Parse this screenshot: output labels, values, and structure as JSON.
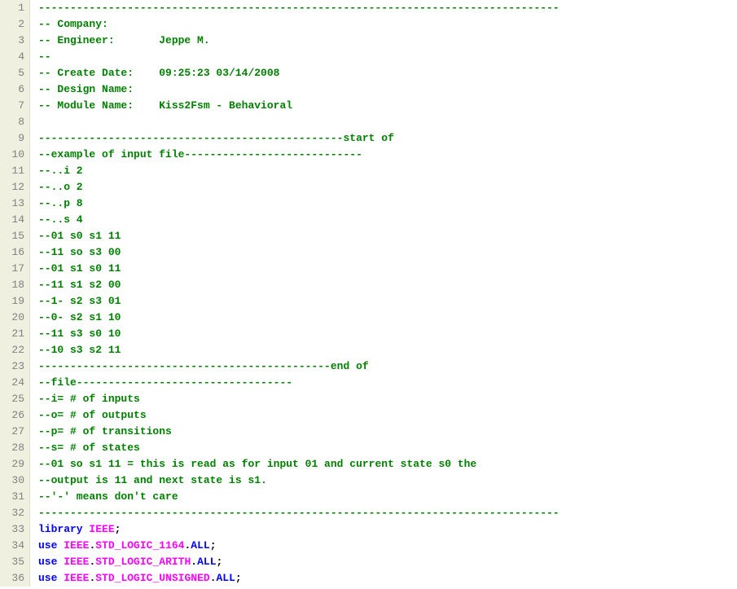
{
  "lines": [
    {
      "n": 1,
      "tokens": [
        {
          "cls": "comment",
          "t": "----------------------------------------------------------------------------------"
        }
      ]
    },
    {
      "n": 2,
      "tokens": [
        {
          "cls": "comment",
          "t": "-- Company: "
        }
      ]
    },
    {
      "n": 3,
      "tokens": [
        {
          "cls": "comment",
          "t": "-- Engineer:       Jeppe M."
        }
      ]
    },
    {
      "n": 4,
      "tokens": [
        {
          "cls": "comment",
          "t": "--"
        }
      ]
    },
    {
      "n": 5,
      "tokens": [
        {
          "cls": "comment",
          "t": "-- Create Date:    09:25:23 03/14/2008"
        }
      ]
    },
    {
      "n": 6,
      "tokens": [
        {
          "cls": "comment",
          "t": "-- Design Name: "
        }
      ]
    },
    {
      "n": 7,
      "tokens": [
        {
          "cls": "comment",
          "t": "-- Module Name:    Kiss2Fsm - Behavioral "
        }
      ]
    },
    {
      "n": 8,
      "tokens": [
        {
          "cls": "comment",
          "t": ""
        }
      ]
    },
    {
      "n": 9,
      "tokens": [
        {
          "cls": "comment",
          "t": "------------------------------------------------start of "
        }
      ]
    },
    {
      "n": 10,
      "tokens": [
        {
          "cls": "comment",
          "t": "--example of input file----------------------------"
        }
      ]
    },
    {
      "n": 11,
      "tokens": [
        {
          "cls": "comment",
          "t": "--..i 2"
        }
      ]
    },
    {
      "n": 12,
      "tokens": [
        {
          "cls": "comment",
          "t": "--..o 2"
        }
      ]
    },
    {
      "n": 13,
      "tokens": [
        {
          "cls": "comment",
          "t": "--..p 8"
        }
      ]
    },
    {
      "n": 14,
      "tokens": [
        {
          "cls": "comment",
          "t": "--..s 4"
        }
      ]
    },
    {
      "n": 15,
      "tokens": [
        {
          "cls": "comment",
          "t": "--01 s0 s1 11"
        }
      ]
    },
    {
      "n": 16,
      "tokens": [
        {
          "cls": "comment",
          "t": "--11 so s3 00"
        }
      ]
    },
    {
      "n": 17,
      "tokens": [
        {
          "cls": "comment",
          "t": "--01 s1 s0 11"
        }
      ]
    },
    {
      "n": 18,
      "tokens": [
        {
          "cls": "comment",
          "t": "--11 s1 s2 00"
        }
      ]
    },
    {
      "n": 19,
      "tokens": [
        {
          "cls": "comment",
          "t": "--1- s2 s3 01"
        }
      ]
    },
    {
      "n": 20,
      "tokens": [
        {
          "cls": "comment",
          "t": "--0- s2 s1 10"
        }
      ]
    },
    {
      "n": 21,
      "tokens": [
        {
          "cls": "comment",
          "t": "--11 s3 s0 10"
        }
      ]
    },
    {
      "n": 22,
      "tokens": [
        {
          "cls": "comment",
          "t": "--10 s3 s2 11"
        }
      ]
    },
    {
      "n": 23,
      "tokens": [
        {
          "cls": "comment",
          "t": "----------------------------------------------end of "
        }
      ]
    },
    {
      "n": 24,
      "tokens": [
        {
          "cls": "comment",
          "t": "--file----------------------------------"
        }
      ]
    },
    {
      "n": 25,
      "tokens": [
        {
          "cls": "comment",
          "t": "--i= # of inputs"
        }
      ]
    },
    {
      "n": 26,
      "tokens": [
        {
          "cls": "comment",
          "t": "--o= # of outputs"
        }
      ]
    },
    {
      "n": 27,
      "tokens": [
        {
          "cls": "comment",
          "t": "--p= # of transitions"
        }
      ]
    },
    {
      "n": 28,
      "tokens": [
        {
          "cls": "comment",
          "t": "--s= # of states"
        }
      ]
    },
    {
      "n": 29,
      "tokens": [
        {
          "cls": "comment",
          "t": "--01 so s1 11 = this is read as for input 01 and current state s0 the "
        }
      ]
    },
    {
      "n": 30,
      "tokens": [
        {
          "cls": "comment",
          "t": "--output is 11 and next state is s1."
        }
      ]
    },
    {
      "n": 31,
      "tokens": [
        {
          "cls": "comment",
          "t": "--'-' means don't care"
        }
      ]
    },
    {
      "n": 32,
      "tokens": [
        {
          "cls": "comment",
          "t": "----------------------------------------------------------------------------------"
        }
      ]
    },
    {
      "n": 33,
      "tokens": [
        {
          "cls": "keyword",
          "t": "library"
        },
        {
          "cls": "punct",
          "t": " "
        },
        {
          "cls": "lib",
          "t": "IEEE"
        },
        {
          "cls": "punct",
          "t": ";"
        }
      ]
    },
    {
      "n": 34,
      "tokens": [
        {
          "cls": "keyword",
          "t": "use"
        },
        {
          "cls": "punct",
          "t": " "
        },
        {
          "cls": "lib",
          "t": "IEEE"
        },
        {
          "cls": "punct",
          "t": "."
        },
        {
          "cls": "lib",
          "t": "STD_LOGIC_1164"
        },
        {
          "cls": "punct",
          "t": "."
        },
        {
          "cls": "keyword",
          "t": "ALL"
        },
        {
          "cls": "punct",
          "t": ";"
        }
      ]
    },
    {
      "n": 35,
      "tokens": [
        {
          "cls": "keyword",
          "t": "use"
        },
        {
          "cls": "punct",
          "t": " "
        },
        {
          "cls": "lib",
          "t": "IEEE"
        },
        {
          "cls": "punct",
          "t": "."
        },
        {
          "cls": "lib",
          "t": "STD_LOGIC_ARITH"
        },
        {
          "cls": "punct",
          "t": "."
        },
        {
          "cls": "keyword",
          "t": "ALL"
        },
        {
          "cls": "punct",
          "t": ";"
        }
      ]
    },
    {
      "n": 36,
      "tokens": [
        {
          "cls": "keyword",
          "t": "use"
        },
        {
          "cls": "punct",
          "t": " "
        },
        {
          "cls": "lib",
          "t": "IEEE"
        },
        {
          "cls": "punct",
          "t": "."
        },
        {
          "cls": "lib",
          "t": "STD_LOGIC_UNSIGNED"
        },
        {
          "cls": "punct",
          "t": "."
        },
        {
          "cls": "keyword",
          "t": "ALL"
        },
        {
          "cls": "punct",
          "t": ";"
        }
      ]
    }
  ]
}
